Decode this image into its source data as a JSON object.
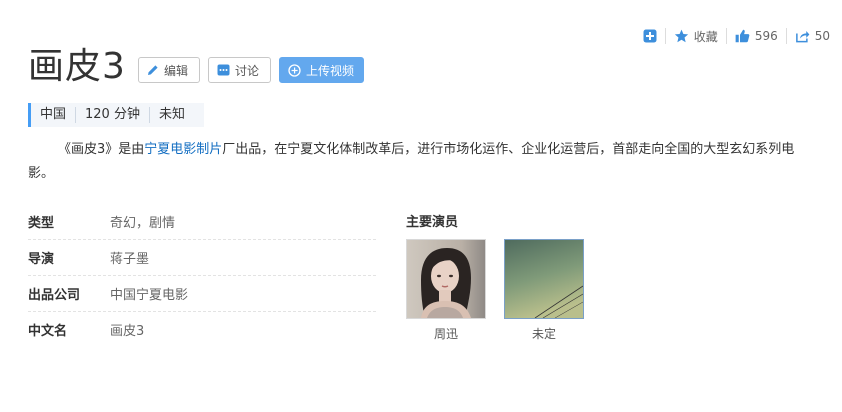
{
  "toolbar": {
    "collect_label": "收藏",
    "like_count": "596",
    "share_count": "50"
  },
  "header": {
    "title": "画皮3",
    "edit_label": "编辑",
    "discuss_label": "讨论",
    "upload_label": "上传视频"
  },
  "meta": [
    "中国",
    "120 分钟",
    "未知"
  ],
  "summary": {
    "prefix": "《画皮3》是由",
    "link": "宁夏电影制片",
    "suffix": "厂出品，在宁夏文化体制改革后，进行市场化运作、企业化运营后，首部走向全国的大型玄幻系列电影。"
  },
  "info": [
    {
      "key": "类型",
      "value": "奇幻，剧情"
    },
    {
      "key": "导演",
      "value": "蒋子墨"
    },
    {
      "key": "出品公司",
      "value": "中国宁夏电影"
    },
    {
      "key": "中文名",
      "value": "画皮3"
    }
  ],
  "cast": {
    "title": "主要演员",
    "actors": [
      {
        "name": "周迅"
      },
      {
        "name": "未定"
      }
    ]
  },
  "colors": {
    "accent": "#459df5",
    "upload_button": "#63a8ee",
    "link": "#136ec2",
    "icon_blue": "#3d8fdc"
  },
  "icons": [
    "plus-square-icon",
    "star-icon",
    "thumbs-up-icon",
    "share-icon",
    "pencil-icon",
    "chat-icon",
    "plus-circle-icon"
  ]
}
